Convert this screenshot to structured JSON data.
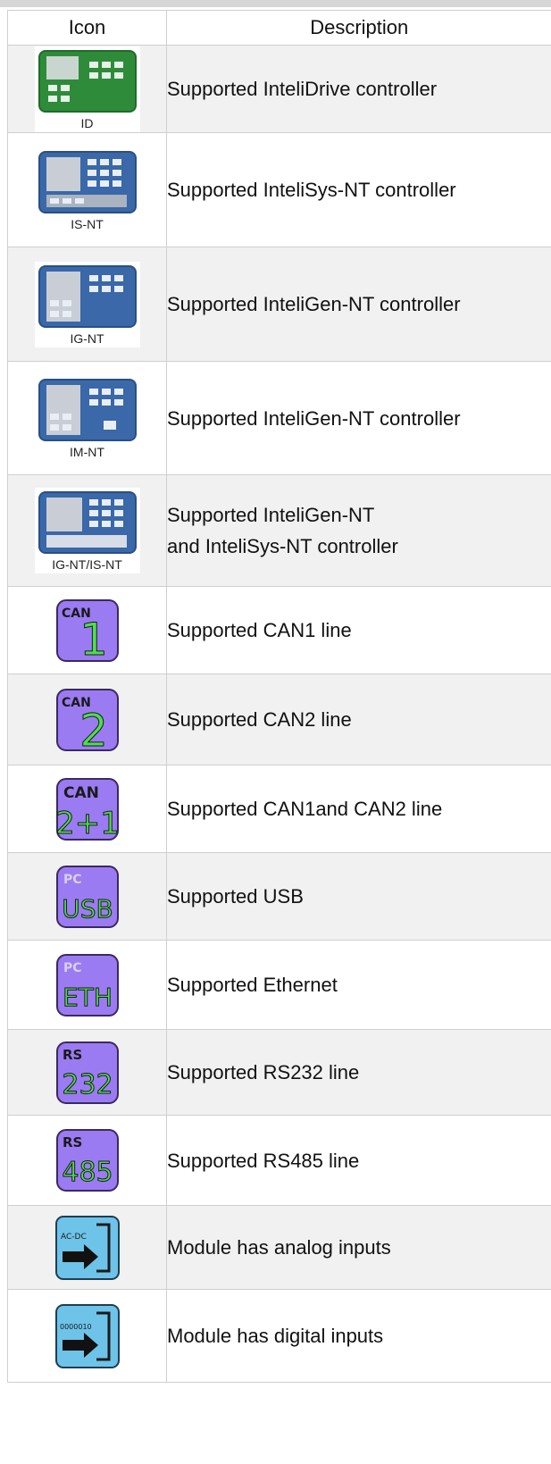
{
  "header": {
    "icon": "Icon",
    "description": "Description"
  },
  "rows": [
    {
      "icon": "id-controller-icon",
      "caption": "ID",
      "description": "Supported InteliDrive controller"
    },
    {
      "icon": "is-nt-controller-icon",
      "caption": "IS-NT",
      "description": "Supported InteliSys-NT controller"
    },
    {
      "icon": "ig-nt-controller-icon",
      "caption": "IG-NT",
      "description": "Supported InteliGen-NT controller"
    },
    {
      "icon": "im-nt-controller-icon",
      "caption": "IM-NT",
      "description": "Supported InteliGen-NT controller"
    },
    {
      "icon": "ig-nt-is-nt-controller-icon",
      "caption": "IG-NT/IS-NT",
      "description": "Supported InteliGen-NT",
      "description2": "and InteliSys-NT controller"
    },
    {
      "icon": "can1-icon",
      "label_top": "CAN",
      "label_main": "1",
      "description": "Supported CAN1 line"
    },
    {
      "icon": "can2-icon",
      "label_top": "CAN",
      "label_main": "2",
      "description": "Supported CAN2 line"
    },
    {
      "icon": "can2-1-icon",
      "label_top": "CAN",
      "label_main": "2+1",
      "description": "Supported CAN1and CAN2 line"
    },
    {
      "icon": "pc-usb-icon",
      "label_top": "PC",
      "label_main": "USB",
      "description": "Supported USB"
    },
    {
      "icon": "pc-eth-icon",
      "label_top": "PC",
      "label_main": "ETH",
      "description": "Supported Ethernet"
    },
    {
      "icon": "rs232-icon",
      "label_top": "RS",
      "label_main": "232",
      "description": "Supported RS232 line"
    },
    {
      "icon": "rs485-icon",
      "label_top": "RS",
      "label_main": "485",
      "description": "Supported RS485 line"
    },
    {
      "icon": "analog-inputs-icon",
      "label_top": "AC-DC",
      "description": "Module has analog inputs"
    },
    {
      "icon": "digital-inputs-icon",
      "label_top": "0000010",
      "description": "Module has digital inputs"
    }
  ],
  "colors": {
    "controller_green": "#2e8b3a",
    "controller_blue": "#3a68a8",
    "port_purple": "#9b7bf2",
    "port_text": "#4be04b",
    "module_blue": "#6ec3e8",
    "stripe": "#f1f1f1",
    "border": "#cfcfcf"
  }
}
